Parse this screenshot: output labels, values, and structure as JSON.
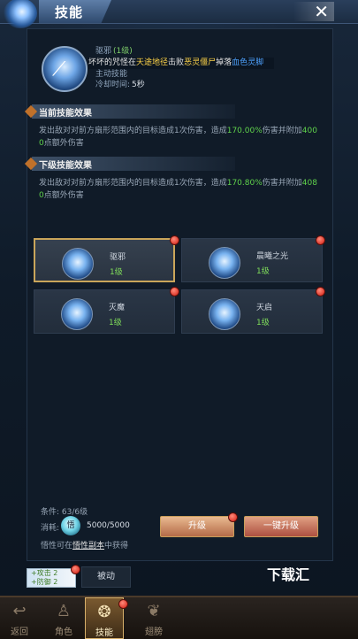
{
  "header": {
    "title": "技能",
    "close_glyph": "✕"
  },
  "skill_detail": {
    "name": "驱邪",
    "level": "(1级)",
    "sub": "主动技能",
    "cooldown_label": "冷却时间:",
    "cooldown_value": "5秒"
  },
  "ticker": {
    "part1": "坏坏的咒怪",
    "part2": "在",
    "part3": "天途地径",
    "part4": "击败",
    "part5": "恶灵僵尸",
    "part6": "掉落",
    "part7": "血色灵脚"
  },
  "current_effect": {
    "title": "当前技能效果",
    "text_a": "发出敌对对前方扇形范围内的目标造成1次伤害，造成",
    "pct": "170.00%",
    "text_b": "伤害并附加",
    "bonus": "400",
    "text_c": "0",
    "text_d": "点额外伤害"
  },
  "next_effect": {
    "title": "下级技能效果",
    "text_a": "发出敌对对前方扇形范围内的目标造成1次伤害，造成",
    "pct": "170.80%",
    "text_b": "伤害并附加",
    "bonus": "408",
    "text_c": "0",
    "text_d": "点额外伤害"
  },
  "skills": [
    {
      "name": "驱邪",
      "level": "1级",
      "icon": "claw-skill-icon"
    },
    {
      "name": "晨曦之光",
      "level": "1级",
      "icon": "comet-skill-icon"
    },
    {
      "name": "灭魔",
      "level": "1级",
      "icon": "slash-skill-icon"
    },
    {
      "name": "天启",
      "level": "1级",
      "icon": "orb-skill-icon"
    }
  ],
  "upgrade": {
    "condition": "条件: 63/6级",
    "cost_label": "消耗:",
    "coin_glyph": "悟",
    "cost_value": "5000/5000",
    "hint_a": "悟性可在",
    "hint_link": "悟性副本",
    "hint_b": "中获得",
    "upgrade_label": "升级",
    "oneclick_label": "一键升级"
  },
  "passive": {
    "pet_line1": "+攻击 2",
    "pet_line2": "+防御 2",
    "button_label": "被动"
  },
  "watermark": "下载汇",
  "nav": [
    {
      "label": "返回",
      "icon": "back-icon"
    },
    {
      "label": "角色",
      "icon": "character-icon"
    },
    {
      "label": "技能",
      "icon": "skill-icon"
    },
    {
      "label": "翅膀",
      "icon": "wings-icon"
    }
  ],
  "colors": {
    "accent_gold": "#c9a55a",
    "value_green": "#5fd24b",
    "badge_red": "#d21b10",
    "link_blue": "#4fa3ff",
    "highlight_yellow": "#ffd54a"
  }
}
